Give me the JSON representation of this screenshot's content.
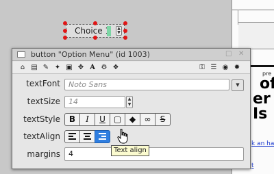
{
  "canvas": {
    "option_menu": {
      "label": "Choice 1"
    }
  },
  "right_document": {
    "pre_text": "pre",
    "heading_line1": "of",
    "heading_line2": "er Is",
    "link1": "k an ha",
    "link2": "t"
  },
  "inspector": {
    "title": "button \"Option Menu\" (id 1003)",
    "window_buttons": [
      "□",
      "✕"
    ],
    "toolbar_icons": [
      "home-icon",
      "database-icon",
      "pencil-icon",
      "magic-wand-icon",
      "image-icon",
      "move-icon",
      "text-icon",
      "network-icon",
      "code-icon",
      "lock-icon",
      "list-icon",
      "target-icon",
      "gear-icon"
    ],
    "properties": {
      "textFont": {
        "label": "textFont",
        "placeholder": "Noto Sans"
      },
      "textSize": {
        "label": "textSize",
        "placeholder": "14"
      },
      "textStyle": {
        "label": "textStyle",
        "buttons": [
          "B",
          "I",
          "U"
        ]
      },
      "textAlign": {
        "label": "textAlign",
        "selected": "right"
      },
      "margins": {
        "label": "margins",
        "value": "4"
      }
    },
    "tooltip": "Text align"
  }
}
